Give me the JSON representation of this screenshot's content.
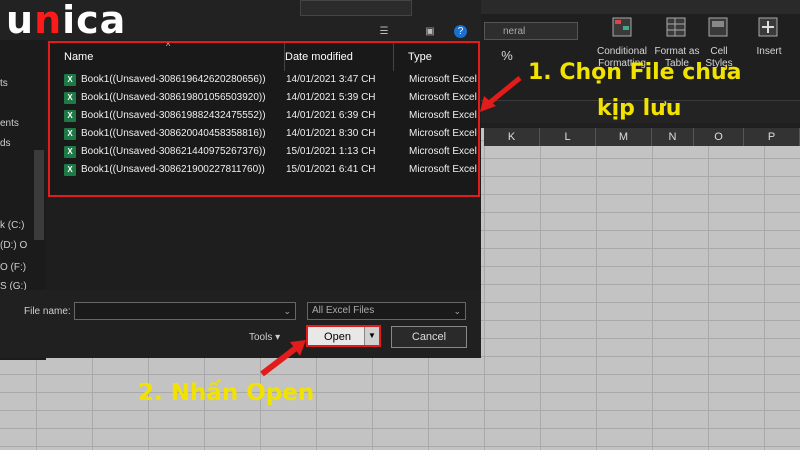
{
  "logo": {
    "text": "unica"
  },
  "excel": {
    "number_format": "neral",
    "ribbon_buttons": [
      {
        "label": "Conditional Formatting"
      },
      {
        "label": "Format as Table"
      },
      {
        "label": "Cell Styles"
      },
      {
        "label": "Insert"
      }
    ],
    "columns": [
      "K",
      "L",
      "M",
      "N",
      "O",
      "P"
    ]
  },
  "dialog": {
    "columns": {
      "name": "Name",
      "date": "Date modified",
      "type": "Type"
    },
    "files": [
      {
        "name": "Book1((Unsaved-308619642620280656))",
        "date": "14/01/2021 3:47 CH",
        "type": "Microsoft Excel"
      },
      {
        "name": "Book1((Unsaved-308619801056503920))",
        "date": "14/01/2021 5:39 CH",
        "type": "Microsoft Excel"
      },
      {
        "name": "Book1((Unsaved-308619882432475552))",
        "date": "14/01/2021 6:39 CH",
        "type": "Microsoft Excel"
      },
      {
        "name": "Book1((Unsaved-308620040458358816))",
        "date": "14/01/2021 8:30 CH",
        "type": "Microsoft Excel"
      },
      {
        "name": "Book1((Unsaved-308621440975267376))",
        "date": "15/01/2021 1:13 CH",
        "type": "Microsoft Excel"
      },
      {
        "name": "Book1((Unsaved-308621900227811760))",
        "date": "15/01/2021 6:41 CH",
        "type": "Microsoft Excel"
      }
    ],
    "nav_items": [
      {
        "label": "k (C:)"
      },
      {
        "label": "(D:) O"
      },
      {
        "label": "O (F:)"
      },
      {
        "label": "S (G:)"
      }
    ],
    "file_name_label": "File name:",
    "file_name_value": "",
    "filter": "All Excel Files",
    "tools_label": "Tools",
    "open_label": "Open",
    "cancel_label": "Cancel"
  },
  "annotations": {
    "step1_line1": "1. Chọn File chưa",
    "step1_line2": "kịp lưu",
    "step2": "2. Nhấn Open"
  },
  "colors": {
    "highlight": "#e21b1b",
    "callout": "#f2e200"
  }
}
